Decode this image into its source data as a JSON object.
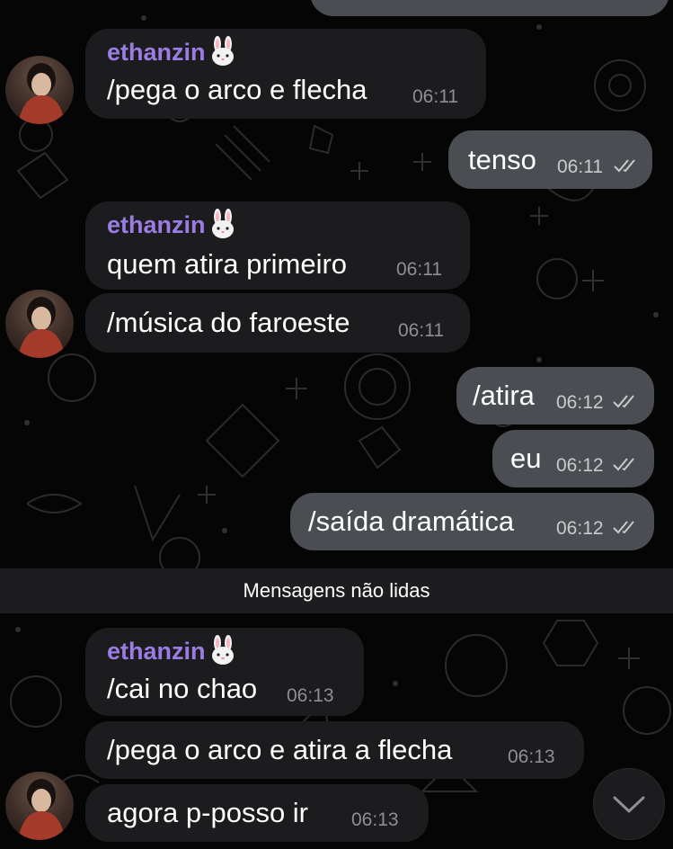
{
  "chat": {
    "unread_divider": "Mensagens não lidas",
    "messages": [
      {
        "sender": "ethanzin",
        "text": "/pega o arco e flecha",
        "time": "06:11"
      },
      {
        "text": "tenso",
        "time": "06:11"
      },
      {
        "sender": "ethanzin",
        "text": "quem atira primeiro",
        "time": "06:11"
      },
      {
        "text": "/música do faroeste",
        "time": "06:11"
      },
      {
        "text": "/atira",
        "time": "06:12"
      },
      {
        "text": "eu",
        "time": "06:12"
      },
      {
        "text": "/saída dramática",
        "time": "06:12"
      },
      {
        "sender": "ethanzin",
        "text": "/cai no chao",
        "time": "06:13"
      },
      {
        "text": "/pega o arco e atira a flecha",
        "time": "06:13"
      },
      {
        "text": "agora p-posso ir",
        "time": "06:13"
      }
    ]
  },
  "icons": {
    "sender_emoji": "rabbit-face-icon",
    "read_receipt": "double-check-icon",
    "scroll_down": "chevron-down-icon"
  },
  "colors": {
    "background": "#050505",
    "incoming_bubble": "#1c1c1e",
    "outgoing_bubble": "#4a4d52",
    "sender_name": "#9b7ce4",
    "timestamp": "#8e8e93"
  }
}
